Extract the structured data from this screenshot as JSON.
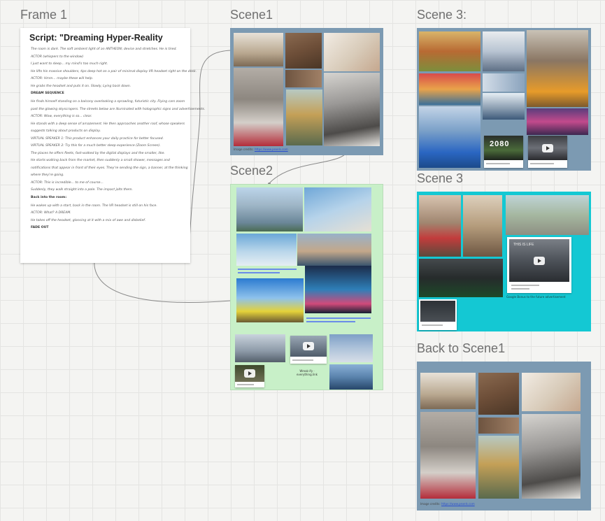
{
  "frames": {
    "frame1": "Frame 1",
    "scene1": "Scene1",
    "scene2": "Scene2",
    "scene3a": "Scene 3:",
    "scene3b": "Scene 3",
    "back": "Back to Scene1"
  },
  "script_doc": {
    "title": "Script: \"Dreaming Hyper-Reality",
    "lines": [
      {
        "text": "The room is dark. The soft ambient light of an ANTHEON; device and stretches. He is tired.",
        "bold": false
      },
      {
        "text": "ACTOR (whispers to the window)",
        "bold": false
      },
      {
        "text": "I just want to sleep... my mind's too much right.",
        "bold": false
      },
      {
        "text": "He lifts his massive shoulders, tips deep hot on a pair of minimal-display VR headset right on the desk.",
        "bold": false
      },
      {
        "text": "ACTOR: Hmm... maybe these will help.",
        "bold": false
      },
      {
        "text": "He grabs the headset and puts it on. Slowly, Lying back down.",
        "bold": false
      },
      {
        "text": "DREAM SEQUENCE",
        "bold": true
      },
      {
        "text": "He finds himself standing on a balcony overlooking a sprawling, futuristic city. Flying cars zoom",
        "bold": false
      },
      {
        "text": "past the glowing skyscrapers. The streets below are illuminated with holographic signs and advertisements.",
        "bold": false
      },
      {
        "text": "ACTOR: Wow, everything is so... clear.",
        "bold": false
      },
      {
        "text": "He stands with a deep sense of amazement. He then approaches another roof, whose speakers",
        "bold": false
      },
      {
        "text": "suggests talking about products on display.",
        "bold": false
      },
      {
        "text": "VIRTUAL SPEAKER 1: This product enhances your daily practice for better focused.",
        "bold": false
      },
      {
        "text": "VIRTUAL SPEAKER 2: Try this for a much better sleep experience (Zoom Screen).",
        "bold": false
      },
      {
        "text": "The places he offers fleets, fast-walked by the digital displays and the smaller, like.",
        "bold": false
      },
      {
        "text": "He starts walking back from the market, then suddenly a small shower, messages and",
        "bold": false
      },
      {
        "text": "notifications that appear in front of their eyes. They're sending the sign, a banner, at the thinking",
        "bold": false
      },
      {
        "text": "where they're going.",
        "bold": false
      },
      {
        "text": "ACTOR: This is incredible... to me of course...",
        "bold": false
      },
      {
        "text": "Suddenly, they walk straight into a pole. The impact jolts them.",
        "bold": false
      },
      {
        "text": "Back into the room:",
        "bold": true
      },
      {
        "text": "He wakes up with a start, back in the room. The VR headset is still on his face.",
        "bold": false
      },
      {
        "text": "ACTOR: What? A DREAM.",
        "bold": false
      },
      {
        "text": "He takes off the headset, glancing at it with a mix of awe and disbelief.",
        "bold": false
      },
      {
        "text": "FADE OUT",
        "bold": true
      }
    ]
  },
  "scene1_caption": {
    "prefix": "Image credits:",
    "link": "https://www.pexels.com"
  },
  "scene2_caption": "Wreak-ify · everything.link",
  "scene3b_caption": "Google Bonus to the future advertisement",
  "back_caption": {
    "prefix": "Image credits:",
    "link": "https://www.pexels.com"
  },
  "video_text": {
    "v2": "2080",
    "v3": "THIS IS LIFE"
  },
  "colors": {
    "board_bg": "#f4f4f2",
    "scene1_bg": "#7c9ab2",
    "scene2_bg": "#c8f0c8",
    "scene3b_bg": "#14c8d3",
    "connector": "#8a8a8a"
  }
}
